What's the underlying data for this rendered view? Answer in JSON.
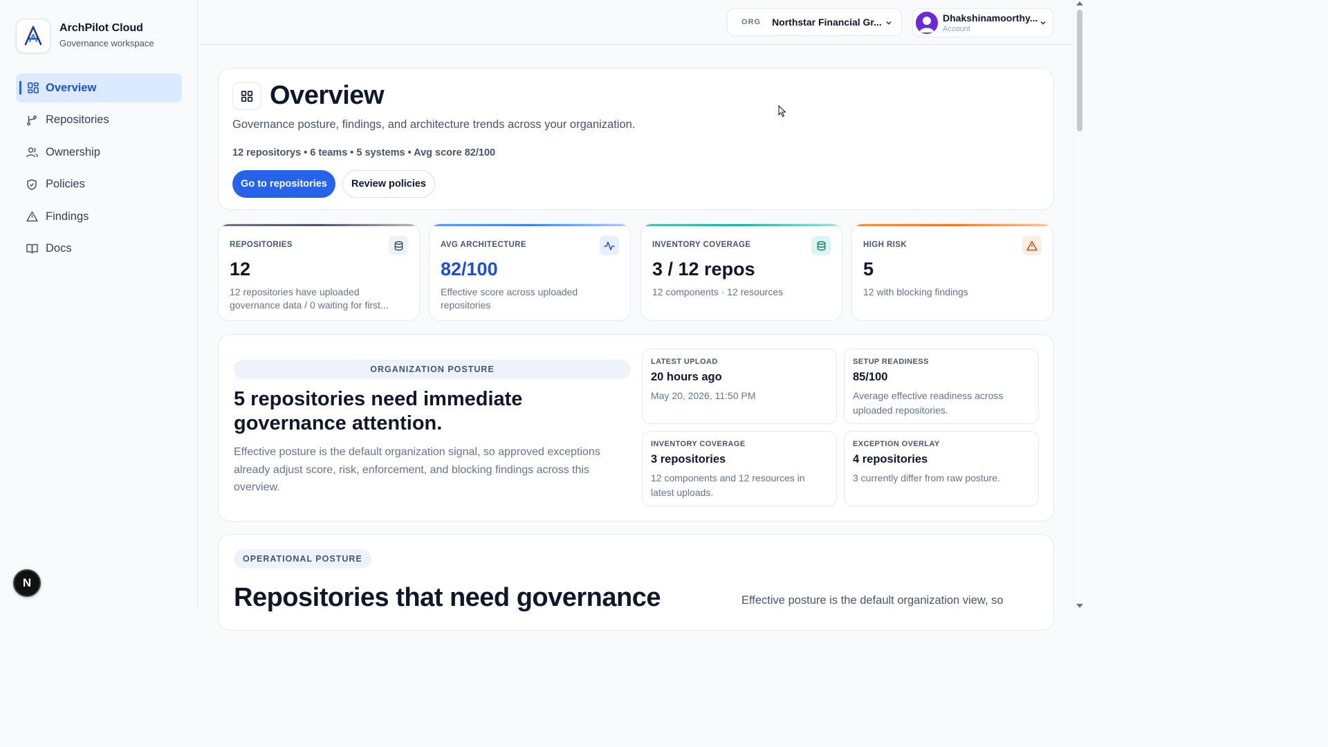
{
  "brand": {
    "name": "ArchPilot Cloud",
    "subtitle": "Governance workspace"
  },
  "nav": [
    {
      "label": "Overview",
      "icon": "grid-icon",
      "active": true
    },
    {
      "label": "Repositories",
      "icon": "git-branch-icon"
    },
    {
      "label": "Ownership",
      "icon": "users-icon"
    },
    {
      "label": "Policies",
      "icon": "shield-icon"
    },
    {
      "label": "Findings",
      "icon": "warning-icon"
    },
    {
      "label": "Docs",
      "icon": "book-icon"
    }
  ],
  "badge": "N",
  "topbar": {
    "org_tag": "ORG",
    "org_name": "Northstar Financial Gr...",
    "account_name": "Dhakshinamoorthy...",
    "account_sub": "Account"
  },
  "hero": {
    "title": "Overview",
    "description": "Governance posture, findings, and architecture trends across your organization.",
    "stats": "12 repositorys • 6 teams • 5 systems • Avg score 82/100",
    "primary_button": "Go to repositories",
    "secondary_button": "Review policies"
  },
  "stats": [
    {
      "label": "REPOSITORIES",
      "value": "12",
      "sub": "12 repositories have uploaded governance data / 0 waiting for first...",
      "icon": "database-icon",
      "accent": "#475569",
      "value_color": "#0f172a"
    },
    {
      "label": "AVG ARCHITECTURE",
      "value": "82/100",
      "sub": "Effective score across uploaded repositories",
      "icon": "activity-icon",
      "accent": "#3b82f6",
      "value_color": "#1d4ed8"
    },
    {
      "label": "INVENTORY COVERAGE",
      "value": "3 / 12 repos",
      "sub": "12 components · 12 resources",
      "icon": "database-icon",
      "accent": "#14b8a6",
      "value_color": "#0f172a"
    },
    {
      "label": "HIGH RISK",
      "value": "5",
      "sub": "12 with blocking findings",
      "icon": "warning-icon",
      "accent": "#f97316",
      "value_color": "#0f172a"
    }
  ],
  "posture": {
    "pill": "ORGANIZATION POSTURE",
    "title": "5 repositories need immediate governance attention.",
    "description": "Effective posture is the default organization signal, so approved exceptions already adjust score, risk, enforcement, and blocking findings across this overview.",
    "cards": [
      {
        "label": "LATEST UPLOAD",
        "value": "20 hours ago",
        "sub": "May 20, 2026, 11:50 PM"
      },
      {
        "label": "SETUP READINESS",
        "value": "85/100",
        "sub": "Average effective readiness across uploaded repositories."
      },
      {
        "label": "INVENTORY COVERAGE",
        "value": "3 repositories",
        "sub": "12 components and 12 resources in latest uploads."
      },
      {
        "label": "EXCEPTION OVERLAY",
        "value": "4 repositories",
        "sub": "3 currently differ from raw posture."
      }
    ]
  },
  "operational": {
    "pill": "OPERATIONAL POSTURE",
    "title": "Repositories that need governance",
    "side_text": "Effective posture is the default organization view, so"
  }
}
